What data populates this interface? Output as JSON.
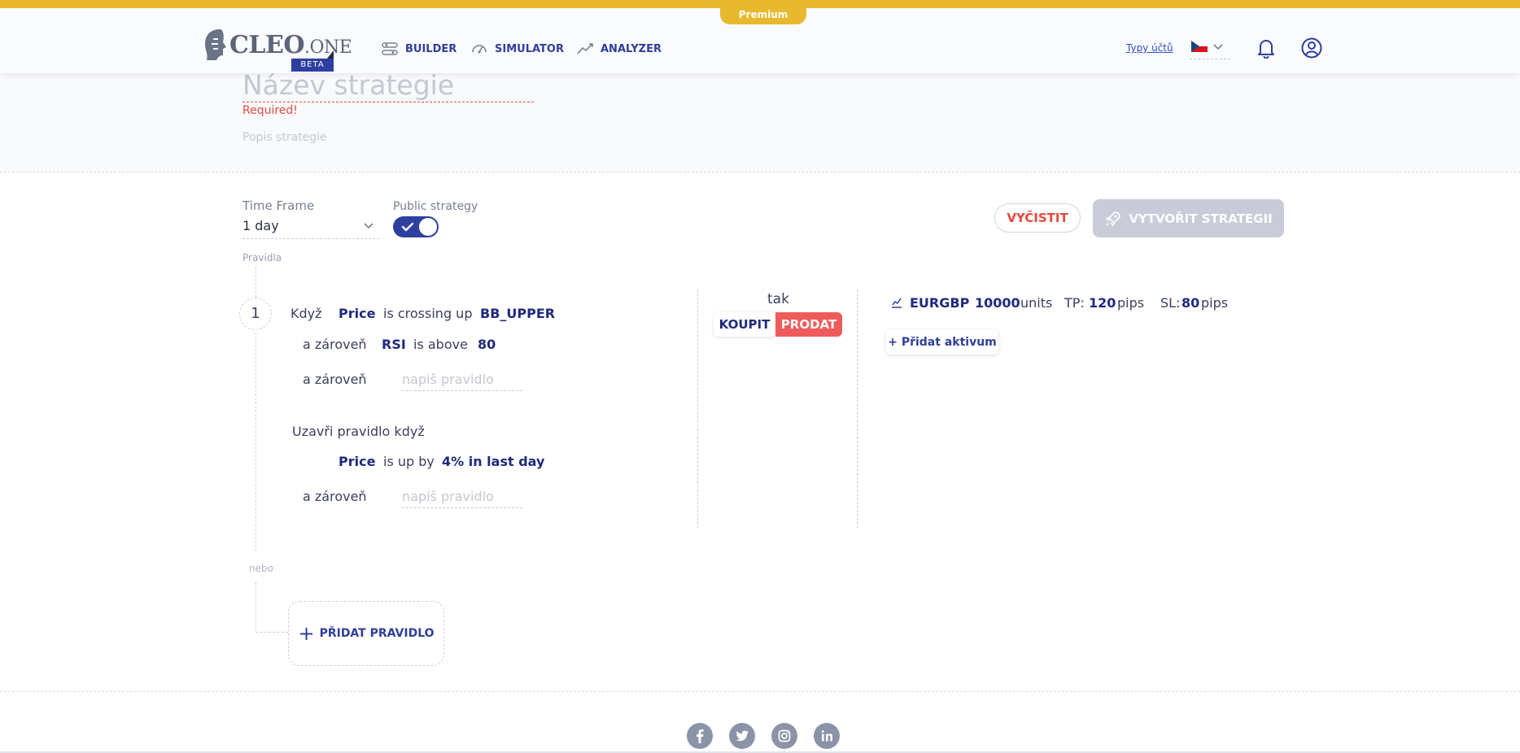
{
  "header": {
    "premium_label": "Premium",
    "logo_main": "CLEO",
    "logo_suffix": ".ONE",
    "logo_badge": "BETA",
    "nav": [
      {
        "label": "BUILDER",
        "icon": "sliders-icon"
      },
      {
        "label": "SIMULATOR",
        "icon": "speedometer-icon"
      },
      {
        "label": "ANALYZER",
        "icon": "trend-line-icon"
      }
    ],
    "account_types_link": "Typy účtů",
    "language_flag": "czech-flag-icon",
    "notification_icon": "bell-icon",
    "profile_icon": "user-circle-icon"
  },
  "strategy": {
    "name_placeholder": "Název strategie",
    "name_error": "Required!",
    "description_placeholder": "Popis strategie"
  },
  "settings": {
    "timeframe_label": "Time Frame",
    "timeframe_value": "1 day",
    "public_label": "Public strategy",
    "public_enabled": true,
    "clear_button": "VYČISTIT",
    "create_button": "VYTVOŘIT STRATEGII"
  },
  "rules": {
    "section_label": "Pravidla",
    "rule_number": "1",
    "when_label": "Když",
    "condition1": {
      "left": "Price",
      "operator": "is crossing up",
      "right": "BB_UPPER"
    },
    "and_label": "a zároveň",
    "condition2": {
      "left": "RSI",
      "operator": "is above",
      "right": "80"
    },
    "rule_placeholder": "napiš pravidlo",
    "close_label": "Uzavři pravidlo když",
    "close_condition": {
      "left": "Price",
      "operator": "is up by",
      "right": "4% in last day"
    },
    "then_label": "tak",
    "buy_label": "KOUPIT",
    "sell_label": "PRODAT",
    "asset": {
      "symbol": "EURGBP",
      "units_value": "10000",
      "units_label": "units",
      "tp_label": "TP:",
      "tp_value": "120",
      "sl_label": "SL:",
      "sl_value": "80",
      "pips_label": "pips"
    },
    "add_asset_label": "+ Přidat aktivum",
    "or_label": "nebo",
    "add_rule_label": "PŘIDAT PRAVIDLO"
  },
  "footer": {
    "social": [
      "facebook-icon",
      "twitter-icon",
      "instagram-icon",
      "linkedin-icon"
    ]
  },
  "colors": {
    "accent_yellow": "#e8b92e",
    "brand_blue": "#2f3fa0",
    "danger_red": "#ef5b5b"
  }
}
